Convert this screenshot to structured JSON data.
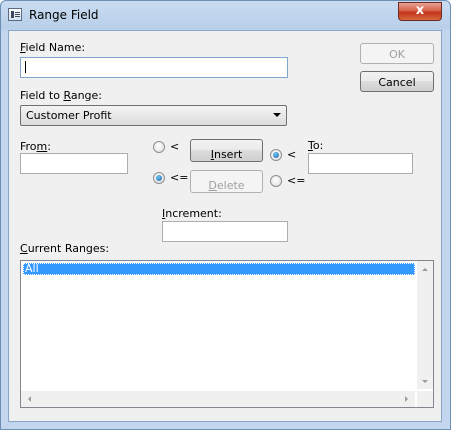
{
  "window": {
    "title": "Range Field",
    "close_glyph": "x"
  },
  "field_name": {
    "label_first": "F",
    "label_rest": "ield Name:",
    "value": ""
  },
  "field_to_range": {
    "label_pre": "Field to ",
    "label_accel": "R",
    "label_post": "ange:",
    "selected": "Customer Profit"
  },
  "from": {
    "label_pre": "Fro",
    "label_accel": "m",
    "label_post": ":",
    "value": ""
  },
  "to": {
    "label_accel": "T",
    "label_post": "o:",
    "value": ""
  },
  "from_operators": {
    "less_than": "<",
    "less_equal": "<=",
    "selected": "<="
  },
  "to_operators": {
    "less_than": "<",
    "less_equal": "<=",
    "selected": "<"
  },
  "buttons": {
    "ok": "OK",
    "cancel": "Cancel",
    "insert_accel": "I",
    "insert_rest": "nsert",
    "delete_accel": "D",
    "delete_rest": "elete"
  },
  "increment": {
    "label_accel": "I",
    "label_rest": "ncrement:",
    "value": ""
  },
  "current_ranges": {
    "label_accel": "C",
    "label_rest": "urrent Ranges:",
    "items": [
      "All"
    ],
    "selected_index": 0
  },
  "icons": [
    "app-window-icon",
    "close-icon",
    "dropdown-arrow-icon",
    "scroll-up-icon",
    "scroll-down-icon",
    "scroll-left-icon",
    "scroll-right-icon"
  ]
}
